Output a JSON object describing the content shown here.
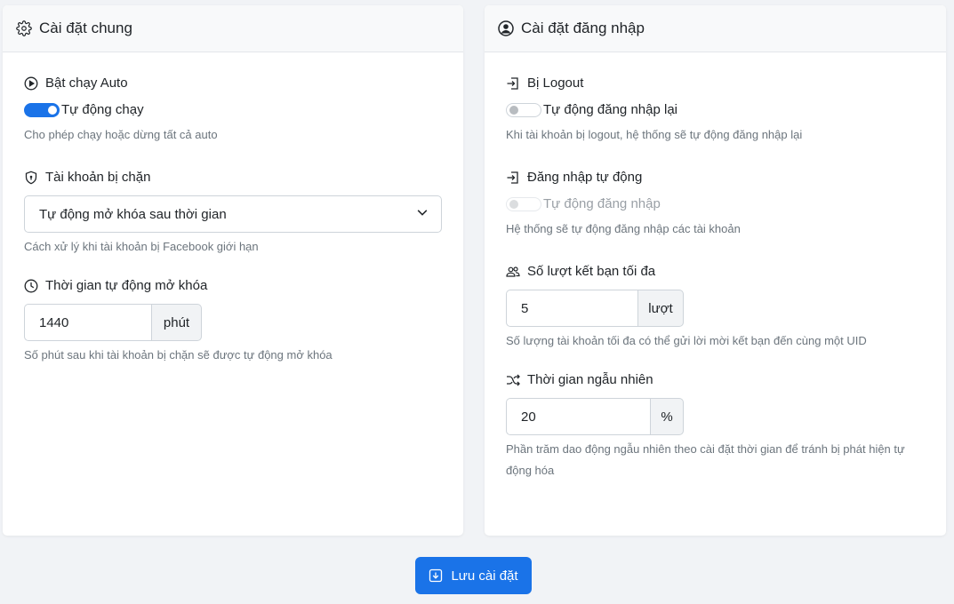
{
  "general": {
    "title": "Cài đặt chung",
    "auto_run": {
      "label": "Bật chạy Auto",
      "switch_label": "Tự động chạy",
      "enabled": true,
      "help": "Cho phép chạy hoặc dừng tất cả auto"
    },
    "blocked": {
      "label": "Tài khoản bị chặn",
      "selected": "Tự động mở khóa sau thời gian",
      "help": "Cách xử lý khi tài khoản bị Facebook giới hạn"
    },
    "unlock_time": {
      "label": "Thời gian tự động mở khóa",
      "value": "1440",
      "unit": "phút",
      "help": "Số phút sau khi tài khoản bị chặn sẽ được tự động mở khóa"
    }
  },
  "login": {
    "title": "Cài đặt đăng nhập",
    "logout": {
      "label": "Bị Logout",
      "switch_label": "Tự động đăng nhập lại",
      "enabled": false,
      "help": "Khi tài khoản bị logout, hệ thống sẽ tự động đăng nhập lại"
    },
    "auto_login": {
      "label": "Đăng nhập tự động",
      "switch_label": "Tự động đăng nhập",
      "enabled": false,
      "disabled": true,
      "help": "Hệ thống sẽ tự động đăng nhập các tài khoản"
    },
    "max_friend": {
      "label": "Số lượt kết bạn tối đa",
      "value": "5",
      "unit": "lượt",
      "help": "Số lượng tài khoản tối đa có thể gửi lời mời kết bạn đến cùng một UID"
    },
    "random_time": {
      "label": "Thời gian ngẫu nhiên",
      "value": "20",
      "unit": "%",
      "help": "Phần trăm dao động ngẫu nhiên theo cài đặt thời gian để tránh bị phát hiện tự động hóa"
    }
  },
  "save_button": "Lưu cài đặt",
  "colors": {
    "accent": "#1a73e8",
    "background": "#f1f3f6"
  }
}
